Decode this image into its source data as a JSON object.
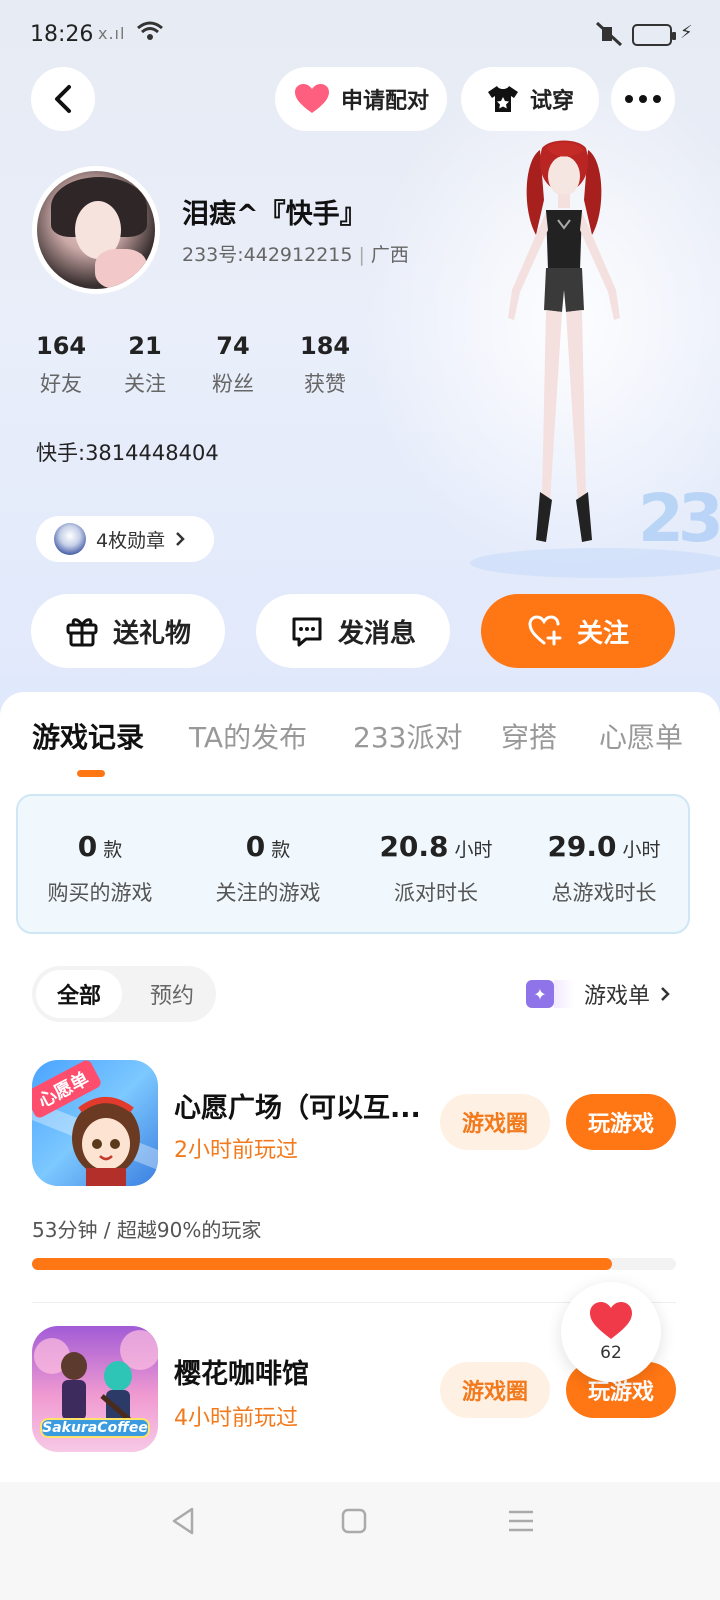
{
  "status_bar": {
    "time": "18:26",
    "signal": "x.ıl"
  },
  "top_bar": {
    "pair_label": "申请配对",
    "tryon_label": "试穿"
  },
  "profile": {
    "name": "泪痣^『快手』",
    "id_text": "233号:442912215",
    "region": "广西",
    "stats": [
      {
        "value": "164",
        "label": "好友"
      },
      {
        "value": "21",
        "label": "关注"
      },
      {
        "value": "74",
        "label": "粉丝"
      },
      {
        "value": "184",
        "label": "获赞"
      }
    ],
    "bio": "快手:3814448404",
    "medal_label": "4枚勋章",
    "watermark": "233"
  },
  "actions": {
    "gift": "送礼物",
    "message": "发消息",
    "follow": "关注"
  },
  "tabs": [
    "游戏记录",
    "TA的发布",
    "233派对",
    "穿搭",
    "心愿单"
  ],
  "summary": [
    {
      "value": "0",
      "unit": "款",
      "label": "购买的游戏"
    },
    {
      "value": "0",
      "unit": "款",
      "label": "关注的游戏"
    },
    {
      "value": "20.8",
      "unit": "小时",
      "label": "派对时长"
    },
    {
      "value": "29.0",
      "unit": "小时",
      "label": "总游戏时长"
    }
  ],
  "filter": {
    "all": "全部",
    "reserve": "预约",
    "game_list": "游戏单"
  },
  "games": [
    {
      "name": "心愿广场（可以互...",
      "last_played": "2小时前玩过",
      "circle_label": "游戏圈",
      "play_label": "玩游戏",
      "icon_badge": "心愿单",
      "progress_text": "53分钟 / 超越90%的玩家",
      "progress_percent": 90
    },
    {
      "name": "樱花咖啡馆",
      "last_played": "4小时前玩过",
      "circle_label": "游戏圈",
      "play_label": "玩游戏",
      "icon_badge": "SakuraCoffee"
    }
  ],
  "like": {
    "count": "62"
  },
  "colors": {
    "accent": "#ff7614",
    "accent_soft": "#fff0e4",
    "time_text": "#f27a1c"
  }
}
